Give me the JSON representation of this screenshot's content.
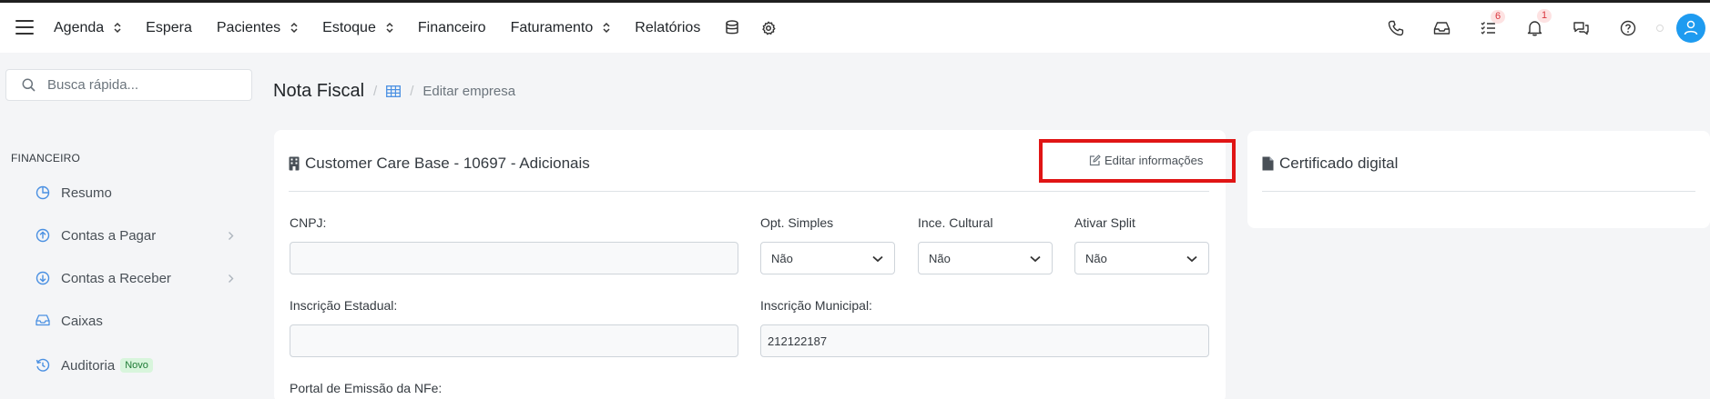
{
  "topbar": {
    "menu_icon": "hamburger-icon",
    "nav": [
      {
        "label": "Agenda",
        "dropdown": true
      },
      {
        "label": "Espera",
        "dropdown": false
      },
      {
        "label": "Pacientes",
        "dropdown": true
      },
      {
        "label": "Estoque",
        "dropdown": true
      },
      {
        "label": "Financeiro",
        "dropdown": false
      },
      {
        "label": "Faturamento",
        "dropdown": true
      },
      {
        "label": "Relatórios",
        "dropdown": false
      }
    ],
    "extra_icons": [
      "database-icon",
      "gear-icon"
    ],
    "right_icons": [
      "phone-icon",
      "inbox-icon",
      "tasks-icon",
      "bell-icon",
      "chat-icon",
      "help-icon"
    ],
    "badges": {
      "tasks": "6",
      "bell": "1"
    },
    "avatar_icon": "user-icon",
    "accent": "#1e9bf0"
  },
  "sidebar": {
    "search_placeholder": "Busca rápida...",
    "section": "FINANCEIRO",
    "items": [
      {
        "label": "Resumo",
        "icon": "pie-chart-icon",
        "chevron": false
      },
      {
        "label": "Contas a Pagar",
        "icon": "arrow-up-circle-icon",
        "chevron": true
      },
      {
        "label": "Contas a Receber",
        "icon": "arrow-down-circle-icon",
        "chevron": true
      },
      {
        "label": "Caixas",
        "icon": "inbox-icon",
        "chevron": false
      },
      {
        "label": "Auditoria",
        "icon": "history-icon",
        "chevron": false,
        "badge": "Novo"
      }
    ]
  },
  "breadcrumb": {
    "title": "Nota Fiscal",
    "separator": "/",
    "icon": "grid-icon",
    "current": "Editar empresa"
  },
  "company_card": {
    "title": "Customer Care Base - 10697 - Adicionais",
    "icon": "building-icon",
    "edit_label": "Editar informações",
    "edit_icon": "edit-icon",
    "highlight_color": "#e01515",
    "fields": {
      "cnpj_label": "CNPJ:",
      "cnpj_value": "",
      "opt_simples_label": "Opt. Simples",
      "opt_simples_value": "Não",
      "ince_cultural_label": "Ince. Cultural",
      "ince_cultural_value": "Não",
      "ativar_split_label": "Ativar Split",
      "ativar_split_value": "Não",
      "inscricao_estadual_label": "Inscrição Estadual:",
      "inscricao_estadual_value": "",
      "inscricao_municipal_label": "Inscrição Municipal:",
      "inscricao_municipal_value": "212122187",
      "portal_label": "Portal de Emissão da NFe:"
    }
  },
  "certificate_card": {
    "title": "Certificado digital",
    "icon": "file-icon"
  }
}
